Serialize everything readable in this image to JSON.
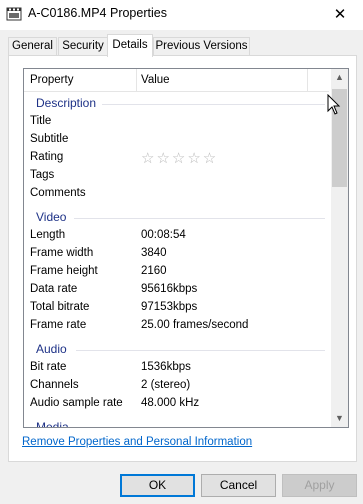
{
  "window": {
    "title": "A-C0186.MP4 Properties",
    "close_glyph": "✕"
  },
  "tabs": [
    {
      "label": "General"
    },
    {
      "label": "Security"
    },
    {
      "label": "Details",
      "active": true
    },
    {
      "label": "Previous Versions"
    }
  ],
  "list": {
    "col_property": "Property",
    "col_value": "Value",
    "groups": {
      "description": "Description",
      "video": "Video",
      "audio": "Audio",
      "media": "Media"
    },
    "description_rows": [
      {
        "k": "Title",
        "v": ""
      },
      {
        "k": "Subtitle",
        "v": ""
      },
      {
        "k": "Rating",
        "v": ""
      },
      {
        "k": "Tags",
        "v": ""
      },
      {
        "k": "Comments",
        "v": ""
      }
    ],
    "rating_stars": "☆☆☆☆☆",
    "video_rows": [
      {
        "k": "Length",
        "v": "00:08:54"
      },
      {
        "k": "Frame width",
        "v": "3840"
      },
      {
        "k": "Frame height",
        "v": "2160"
      },
      {
        "k": "Data rate",
        "v": "95616kbps"
      },
      {
        "k": "Total bitrate",
        "v": "97153kbps"
      },
      {
        "k": "Frame rate",
        "v": "25.00 frames/second"
      }
    ],
    "audio_rows": [
      {
        "k": "Bit rate",
        "v": "1536kbps"
      },
      {
        "k": "Channels",
        "v": "2 (stereo)"
      },
      {
        "k": "Audio sample rate",
        "v": "48.000 kHz"
      }
    ]
  },
  "link": "Remove Properties and Personal Information",
  "buttons": {
    "ok": "OK",
    "cancel": "Cancel",
    "apply": "Apply"
  },
  "colors": {
    "group_header": "#1e3287",
    "link": "#0066cc"
  }
}
